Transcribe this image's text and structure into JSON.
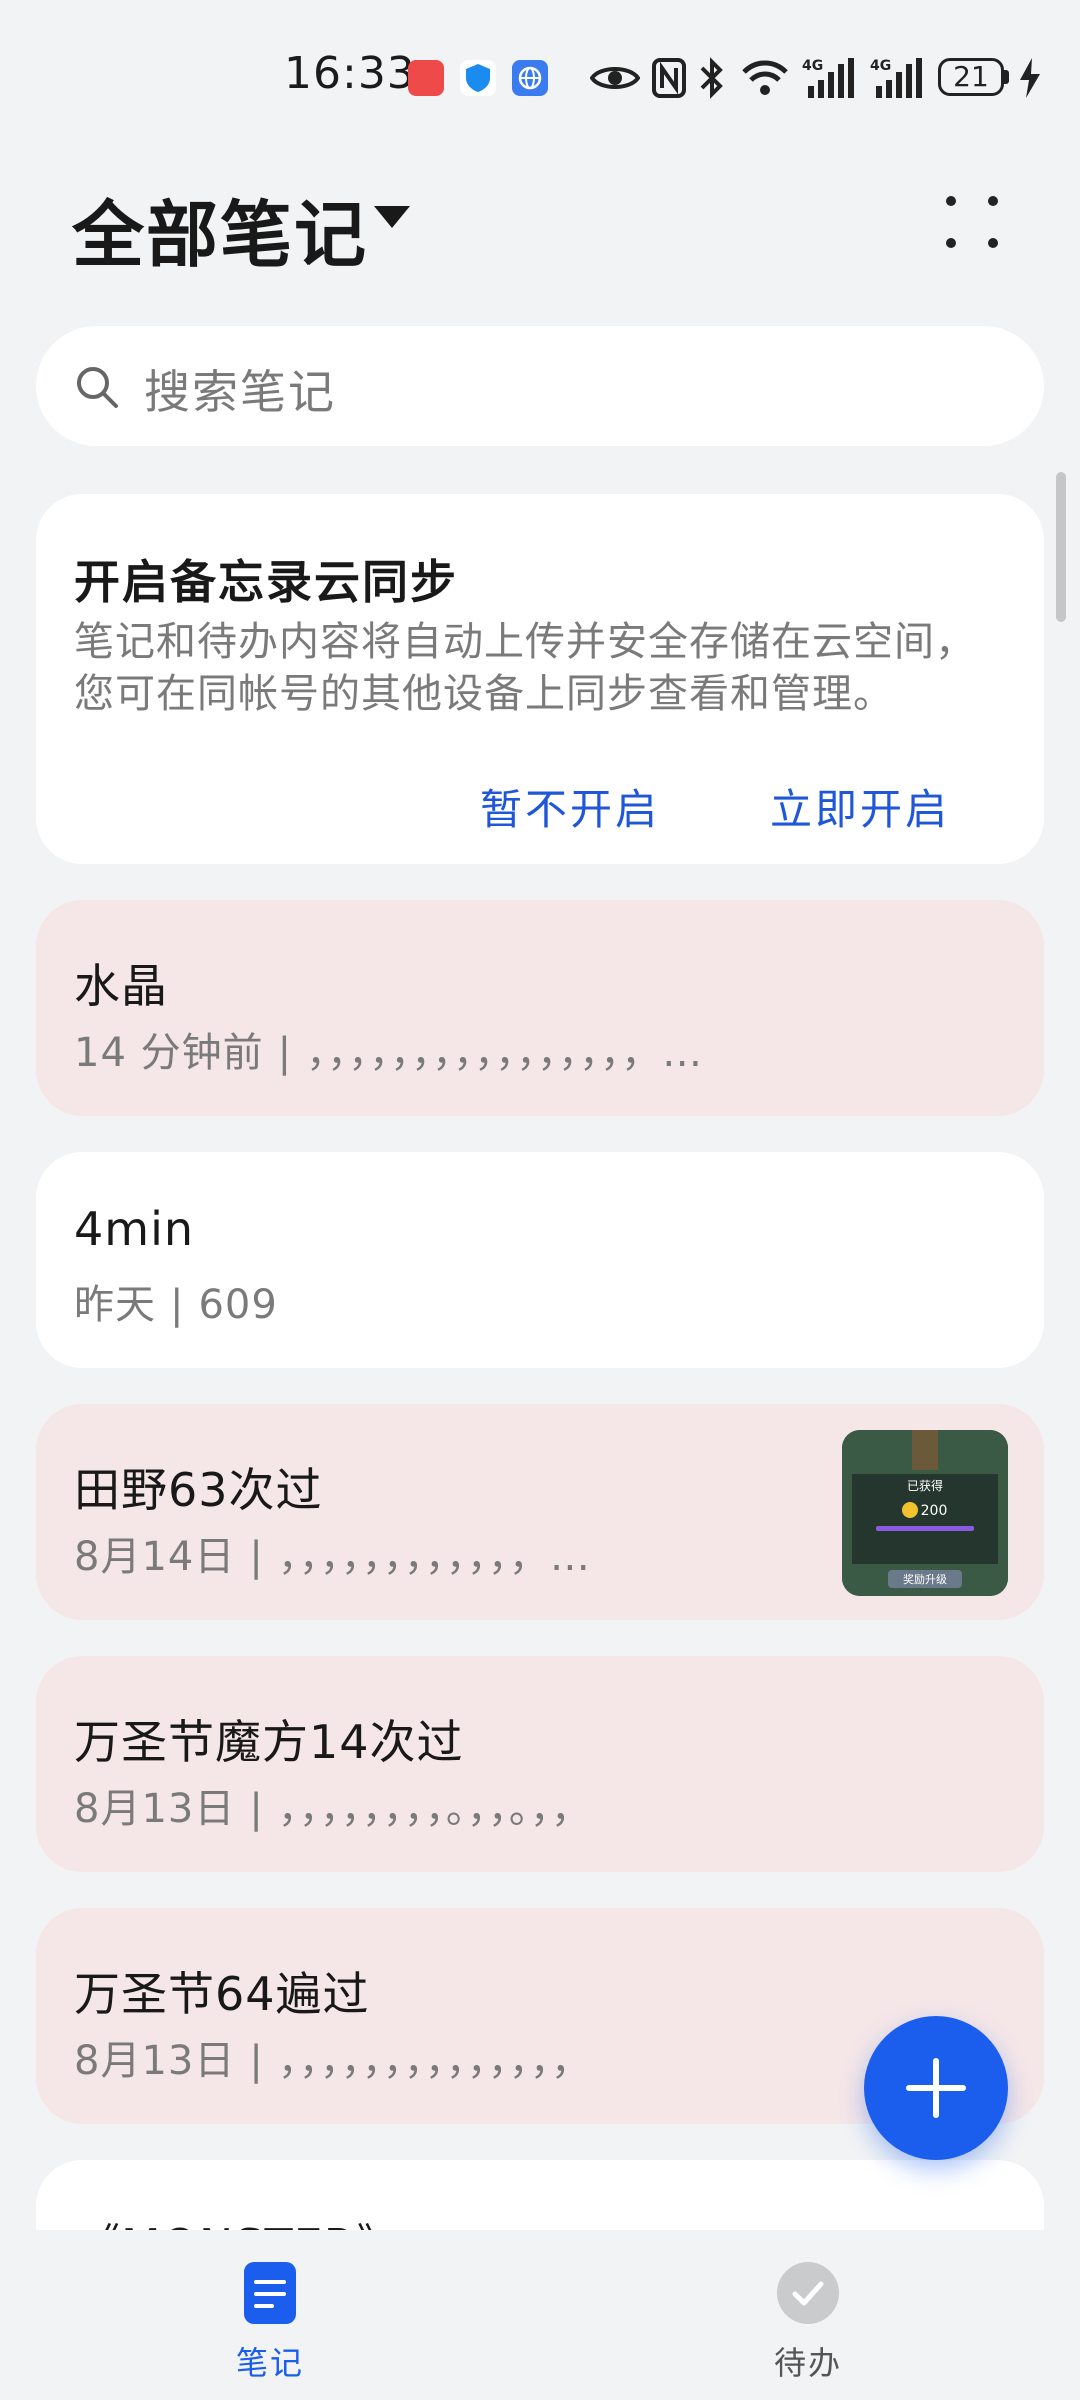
{
  "status_bar": {
    "time": "16:33",
    "battery": "21",
    "icons": [
      "eye-icon",
      "nfc-icon",
      "bluetooth-icon",
      "wifi-icon",
      "signal-4g-icon",
      "signal-4g-icon",
      "battery-icon",
      "charging-icon"
    ]
  },
  "header": {
    "title": "全部笔记",
    "more_icon": "more-dots-icon"
  },
  "search": {
    "placeholder": "搜索笔记"
  },
  "sync_card": {
    "title": "开启备忘录云同步",
    "description": "笔记和待办内容将自动上传并安全存储在云空间，您可在同帐号的其他设备上同步查看和管理。",
    "later_label": "暂不开启",
    "now_label": "立即开启"
  },
  "notes": [
    {
      "title": "水晶",
      "time": "14 分钟前",
      "preview": "，，，，，，，，，，，，，，，，…",
      "color": "#f5e7e8"
    },
    {
      "title": "4min",
      "time": "昨天",
      "preview": "609",
      "color": "#ffffff"
    },
    {
      "title": "田野63次过",
      "time": "8月14日",
      "preview": "，，，，，，，，，，，，…",
      "color": "#f5e7e8",
      "thumbnail": {
        "label": "已获得",
        "value": "200",
        "button": "奖励升级"
      }
    },
    {
      "title": "万圣节魔方14次过",
      "time": "8月13日",
      "preview": "，，，，，，，，。，，。，，",
      "color": "#f5e7e8"
    },
    {
      "title": "万圣节64遍过",
      "time": "8月13日",
      "preview": "，，，，，，，，，，，，，，",
      "color": "#f5e7e8"
    },
    {
      "title": "《MONSTER》",
      "color": "#ffffff"
    }
  ],
  "fab": {
    "icon": "plus-icon"
  },
  "bottom_nav": {
    "notes_label": "笔记",
    "todo_label": "待办"
  },
  "colors": {
    "accent": "#1b5eee",
    "link": "#1f57d8",
    "pink_card": "#f5e7e8",
    "background": "#f1f3f5"
  }
}
